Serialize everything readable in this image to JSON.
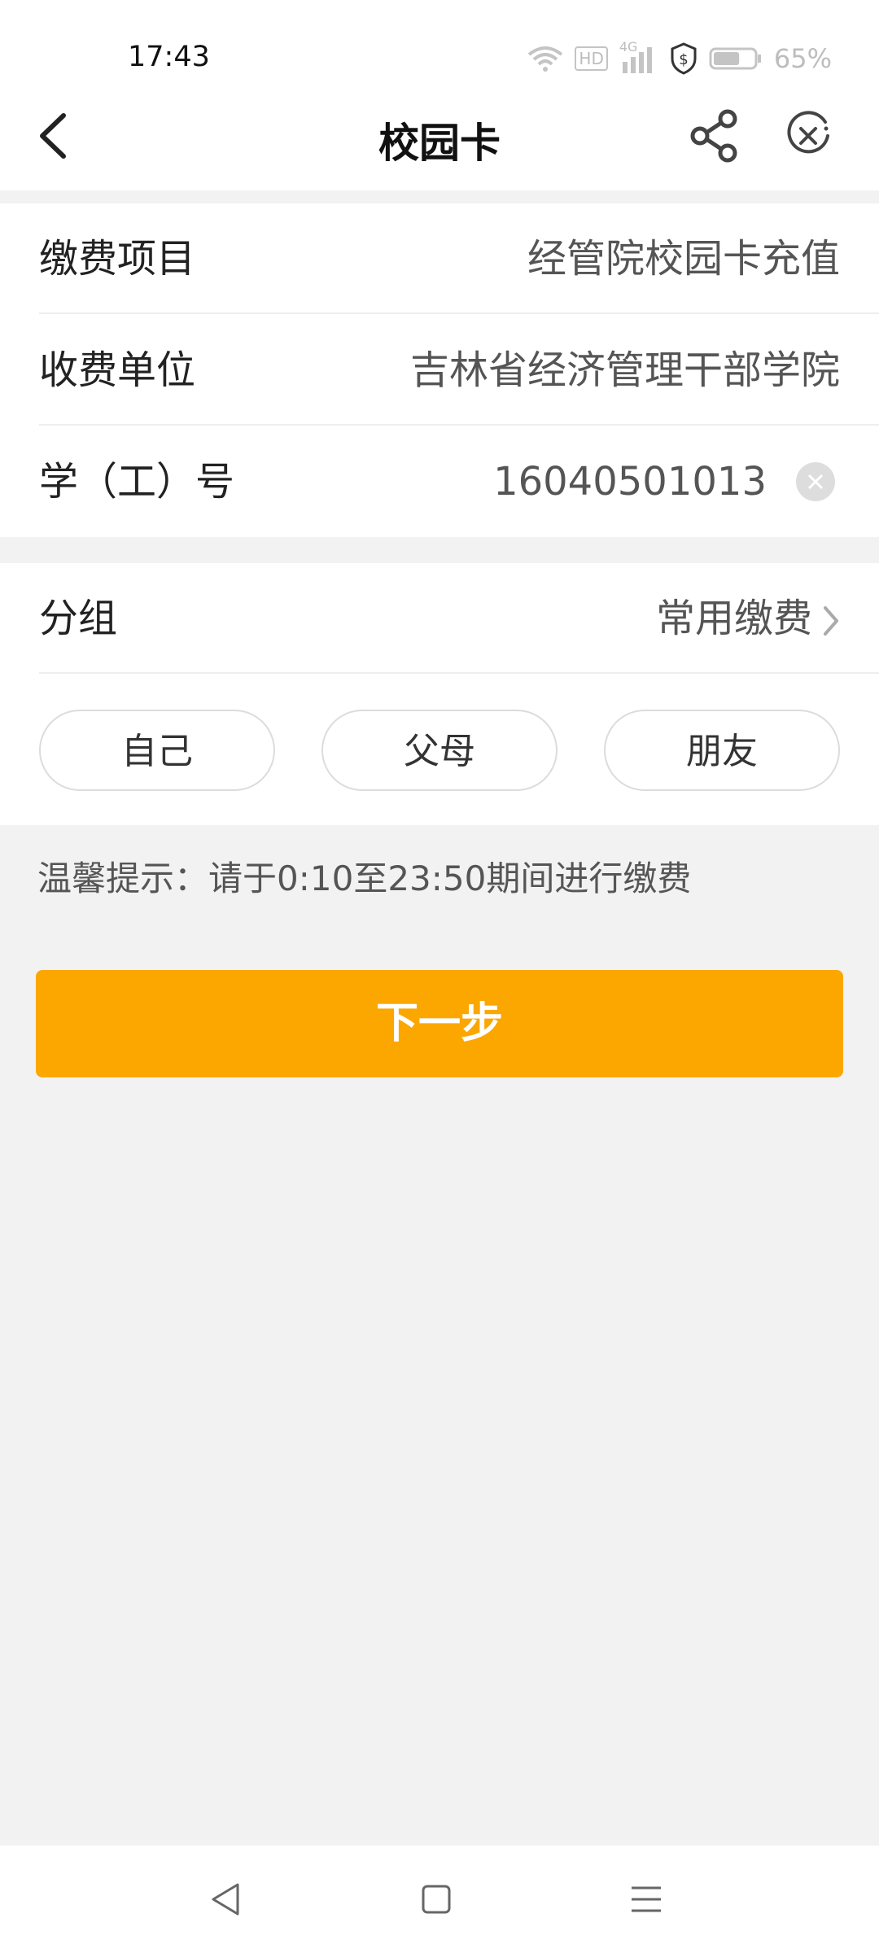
{
  "status": {
    "time": "17:43",
    "battery_text": "65%",
    "network_label": "4G",
    "hd_label": "HD",
    "battery_level": 0.65
  },
  "header": {
    "title": "校园卡",
    "back_icon": "chevron-left-icon",
    "share_icon": "share-icon",
    "close_icon": "close-circle-icon"
  },
  "form": {
    "rows": [
      {
        "label": "缴费项目",
        "value": "经管院校园卡充值"
      },
      {
        "label": "收费单位",
        "value": "吉林省经济管理干部学院"
      },
      {
        "label": "学（工）号",
        "value": "16040501013"
      }
    ],
    "group": {
      "label": "分组",
      "value": "常用缴费"
    },
    "chips": [
      "自己",
      "父母",
      "朋友"
    ]
  },
  "tip": "温馨提示：请于0:10至23:50期间进行缴费",
  "next_button": "下一步",
  "colors": {
    "accent": "#fba700",
    "background": "#f2f2f2"
  }
}
